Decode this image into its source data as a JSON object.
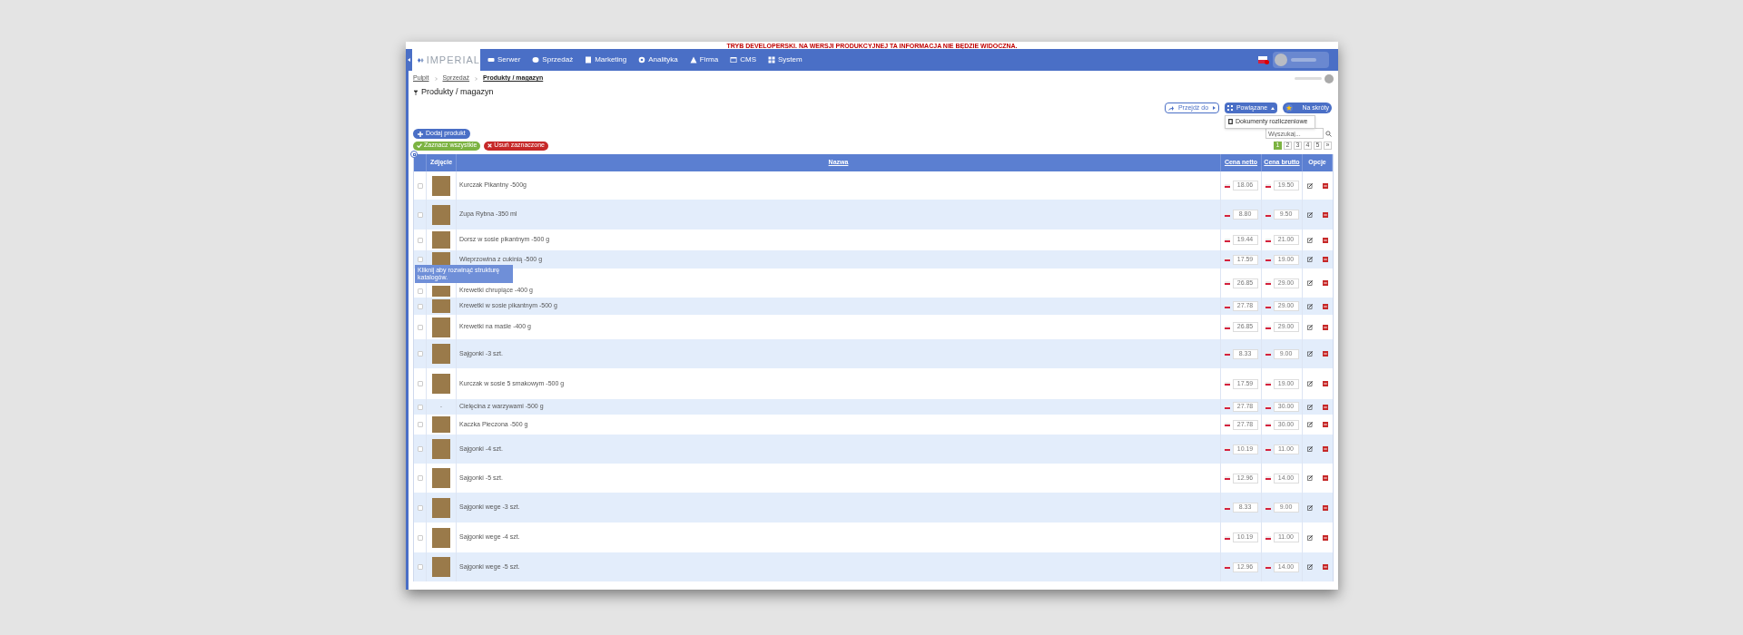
{
  "dev_notice": "TRYB DEVELOPERSKI. NA WERSJI PRODUKCYJNEJ TA INFORMACJA NIE BĘDZIE WIDOCZNA.",
  "logo": "IMPERIAL",
  "nav": [
    {
      "label": "Serwer"
    },
    {
      "label": "Sprzedaż"
    },
    {
      "label": "Marketing"
    },
    {
      "label": "Analityka"
    },
    {
      "label": "Firma"
    },
    {
      "label": "CMS"
    },
    {
      "label": "System"
    }
  ],
  "breadcrumbs": [
    {
      "label": "Pulpit"
    },
    {
      "label": "Sprzedaż"
    },
    {
      "label": "Produkty / magazyn"
    }
  ],
  "page_title": "Produkty / magazyn",
  "toolbar": [
    {
      "label": "Przejdź do",
      "kind": "goto"
    },
    {
      "label": "Powiązane",
      "kind": "related",
      "expanded": true
    },
    {
      "label": "Na skróty",
      "kind": "shortcut"
    }
  ],
  "related_menu": [
    "Dokumenty rozliczeniowe"
  ],
  "search": {
    "placeholder": "Wyszukaj..."
  },
  "add_button": "Dodaj produkt",
  "select_all": "Zaznacz wszystkie",
  "delete_selected": "Usuń zaznaczone",
  "pagination": [
    {
      "label": "1",
      "selected": true
    },
    {
      "label": "2",
      "selected": false
    },
    {
      "label": "3",
      "selected": false
    },
    {
      "label": "4",
      "selected": false
    },
    {
      "label": "5",
      "selected": false
    },
    {
      "label": "»",
      "selected": false
    }
  ],
  "catalog_toggle": {
    "expanded": false
  },
  "tooltip": "Kliknij aby rozwinąć strukturę katalogów.",
  "table": {
    "columns": [
      "Zdjęcie",
      "Nazwa",
      "Cena netto",
      "Cena brutto",
      "Opcje"
    ],
    "rows": [
      {
        "name": "Kurczak Pikantny -500g",
        "net": "18.06",
        "gross": "19.50",
        "checked": false
      },
      {
        "name": "Zupa Rybna -350 ml",
        "net": "8.80",
        "gross": "9.50",
        "checked": false
      },
      {
        "name": "Dorsz w sosie pikantnym -500 g",
        "net": "19.44",
        "gross": "21.00",
        "checked": false
      },
      {
        "name": "Wieprzowina z cukinią -500 g",
        "net": "17.59",
        "gross": "19.00",
        "checked": false
      },
      {
        "name": "Krewetki chrupiące -400 g",
        "net": "26.85",
        "gross": "29.00",
        "checked": false
      },
      {
        "name": "Krewetki w sosie pikantnym -500 g",
        "net": "27.78",
        "gross": "29.00",
        "checked": false
      },
      {
        "name": "Krewetki na maśle -400 g",
        "net": "26.85",
        "gross": "29.00",
        "checked": false
      },
      {
        "name": "Sajgonki -3 szt.",
        "net": "8.33",
        "gross": "9.00",
        "checked": false
      },
      {
        "name": "Kurczak w sosie 5 smakowym -500 g",
        "net": "17.59",
        "gross": "19.00",
        "checked": false
      },
      {
        "no_photo": "-",
        "name": "Cielęcina z warzywami -500 g",
        "net": "27.78",
        "gross": "30.00",
        "checked": false
      },
      {
        "name": "Kaczka Pieczona -500 g",
        "net": "27.78",
        "gross": "30.00",
        "checked": false
      },
      {
        "name": "Sajgonki -4 szt.",
        "net": "10.19",
        "gross": "11.00",
        "checked": false
      },
      {
        "name": "Sajgonki -5 szt.",
        "net": "12.96",
        "gross": "14.00",
        "checked": false
      },
      {
        "name": "Sajgonki wege -3 szt.",
        "net": "8.33",
        "gross": "9.00",
        "checked": false
      },
      {
        "name": "Sajgonki wege -4 szt.",
        "net": "10.19",
        "gross": "11.00",
        "checked": false
      },
      {
        "name": "Sajgonki wege -5 szt.",
        "net": "12.96",
        "gross": "14.00",
        "checked": false
      }
    ]
  }
}
